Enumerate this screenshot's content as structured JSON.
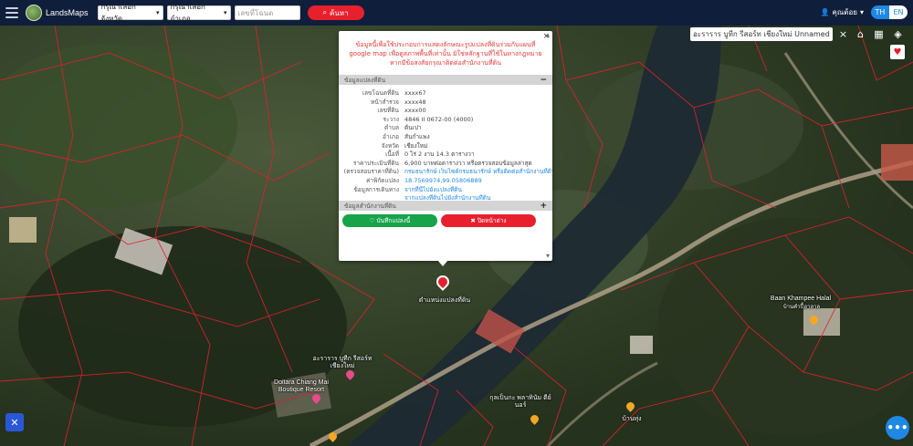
{
  "topbar": {
    "brand": "LandsMaps",
    "province_select": "กรุณาเลือกจังหวัด",
    "amphoe_select": "กรุณาเลือกอำเภอ",
    "deed_placeholder": "เลขที่โฉนด",
    "search_label": "ค้นหา",
    "user_label": "คุณต้อย",
    "lang_th": "TH",
    "lang_en": "EN"
  },
  "map": {
    "search_value": "อะราราร บูทีก รีสอร์ท เชียงใหม่ Unnamed Road",
    "main_pin_label": "ตำแหน่งแปลงที่ดิน",
    "places": [
      {
        "name": "Baan Khampee Halal"
      },
      {
        "name": "บ้านคำปี้ฮาลาล"
      },
      {
        "name": "อะราราร บูทีก รีสอร์ท เชียงใหม่"
      },
      {
        "name": "Doitara Chiang Mai Boutique Resort"
      },
      {
        "name": "กุลเป็นกะ พลาทินัม ดีย์นอร์"
      },
      {
        "name": "บ้านทุ่ง"
      }
    ]
  },
  "popup": {
    "notice": "ข้อมูลนี้เพื่อใช้ประกอบการแสดงลักษณะรูปแปลงที่ดินร่วมกับแผนที่ google map เพื่อดูสภาพพื้นที่เท่านั้น มิใช่หลักฐานที่ใช้ในทางกฎหมาย หากมีข้อสงสัยกรุณาติดต่อสำนักงานที่ดิน",
    "section1_title": "ข้อมูลแปลงที่ดิน",
    "section1_toggle": "−",
    "rows": [
      {
        "k": "เลขโฉนดที่ดิน",
        "v": "xxxx67",
        "link": false
      },
      {
        "k": "หน้าสำรวจ",
        "v": "xxxx48",
        "link": false
      },
      {
        "k": "เลขที่ดิน",
        "v": "xxxx00",
        "link": false
      },
      {
        "k": "ระวาง",
        "v": "4846 II 0672-00 (4000)",
        "link": false
      },
      {
        "k": "ตำบล",
        "v": "ต้นเปา",
        "link": false
      },
      {
        "k": "อำเภอ",
        "v": "สันกำแพง",
        "link": false
      },
      {
        "k": "จังหวัด",
        "v": "เชียงใหม่",
        "link": false
      },
      {
        "k": "เนื้อที่",
        "v": "0 ไร่ 2 งาน 14.3 ตารางวา",
        "link": false
      },
      {
        "k": "ราคาประเมินที่ดิน",
        "v": "6,900 บาทต่อตารางวา หรือตรวจสอบข้อมูลล่าสุด",
        "link": false
      },
      {
        "k": "(ตรวจสอบราคาที่ดิน)",
        "v": "กรมธนารักษ์ เว็บไซต์กรมธนารักษ์ หรือติดต่อสำนักงานที่ดิน",
        "link": true
      },
      {
        "k": "ค่าพิกัดแปลง",
        "v": "18.7569974,99.05806889",
        "link": true
      },
      {
        "k": "ข้อมูลการเดินทาง",
        "v": "จากที่นี่ไปยังแปลงที่ดิน",
        "link": true
      },
      {
        "k": "",
        "v": "จากแปลงที่ดินไปยังสำนักงานที่ดิน",
        "link": true
      }
    ],
    "section2_title": "ข้อมูลสำนักงานที่ดิน",
    "section2_toggle": "+",
    "save_label": "บันทึกแปลงนี้",
    "close_label": "ปิดหน้าต่าง",
    "close_x": "×"
  }
}
